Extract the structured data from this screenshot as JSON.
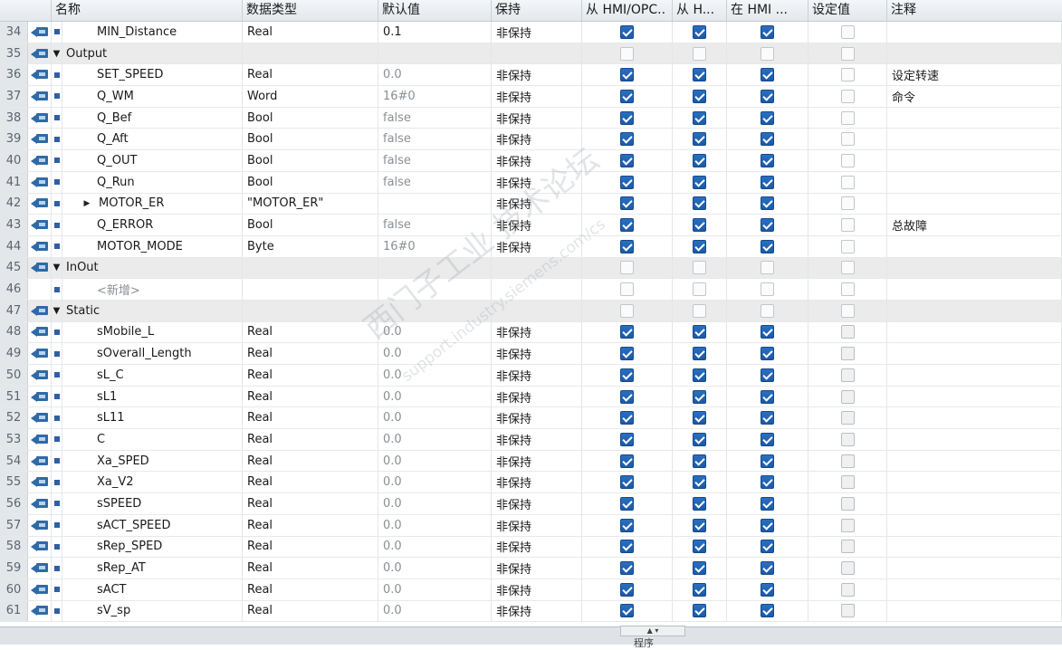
{
  "headers": {
    "name": "名称",
    "type": "数据类型",
    "default": "默认值",
    "retain": "保持",
    "col_hmi_opc": "从 HMI/OPC..",
    "col_h": "从 H...",
    "col_in_hmi": "在 HMI ...",
    "col_setpoint": "设定值",
    "comment": "注释"
  },
  "rows": [
    {
      "n": "34",
      "kind": "var",
      "name": "MIN_Distance",
      "type": "Real",
      "dflt": "0.1",
      "dflt_style": "bright",
      "keep": "非保持",
      "c1": "on",
      "c2": "on",
      "c3": "on",
      "c4": "off",
      "cmt": ""
    },
    {
      "n": "35",
      "kind": "section",
      "name": "Output"
    },
    {
      "n": "36",
      "kind": "var",
      "name": "SET_SPEED",
      "type": "Real",
      "dflt": "0.0",
      "keep": "非保持",
      "c1": "on",
      "c2": "on",
      "c3": "on",
      "c4": "off",
      "cmt": "设定转速"
    },
    {
      "n": "37",
      "kind": "var",
      "name": "Q_WM",
      "type": "Word",
      "dflt": "16#0",
      "keep": "非保持",
      "c1": "on",
      "c2": "on",
      "c3": "on",
      "c4": "off",
      "cmt": "命令"
    },
    {
      "n": "38",
      "kind": "var",
      "name": "Q_Bef",
      "type": "Bool",
      "dflt": "false",
      "keep": "非保持",
      "c1": "on",
      "c2": "on",
      "c3": "on",
      "c4": "off",
      "cmt": ""
    },
    {
      "n": "39",
      "kind": "var",
      "name": "Q_Aft",
      "type": "Bool",
      "dflt": "false",
      "keep": "非保持",
      "c1": "on",
      "c2": "on",
      "c3": "on",
      "c4": "off",
      "cmt": ""
    },
    {
      "n": "40",
      "kind": "var",
      "name": "Q_OUT",
      "type": "Bool",
      "dflt": "false",
      "keep": "非保持",
      "c1": "on",
      "c2": "on",
      "c3": "on",
      "c4": "off",
      "cmt": ""
    },
    {
      "n": "41",
      "kind": "var",
      "name": "Q_Run",
      "type": "Bool",
      "dflt": "false",
      "keep": "非保持",
      "c1": "on",
      "c2": "on",
      "c3": "on",
      "c4": "off",
      "cmt": ""
    },
    {
      "n": "42",
      "kind": "struct",
      "name": "MOTOR_ER",
      "type": "\"MOTOR_ER\"",
      "dflt": "",
      "keep": "非保持",
      "c1": "on",
      "c2": "on",
      "c3": "on",
      "c4": "off",
      "cmt": ""
    },
    {
      "n": "43",
      "kind": "var",
      "name": "Q_ERROR",
      "type": "Bool",
      "dflt": "false",
      "keep": "非保持",
      "c1": "on",
      "c2": "on",
      "c3": "on",
      "c4": "off",
      "cmt": "总故障"
    },
    {
      "n": "44",
      "kind": "var",
      "name": "MOTOR_MODE",
      "type": "Byte",
      "dflt": "16#0",
      "keep": "非保持",
      "c1": "on",
      "c2": "on",
      "c3": "on",
      "c4": "off",
      "cmt": ""
    },
    {
      "n": "45",
      "kind": "section",
      "name": "InOut"
    },
    {
      "n": "46",
      "kind": "placeholder",
      "name": "<新增>"
    },
    {
      "n": "47",
      "kind": "section",
      "name": "Static"
    },
    {
      "n": "48",
      "kind": "var",
      "name": "sMobile_L",
      "type": "Real",
      "dflt": "0.0",
      "keep": "非保持",
      "c1": "on",
      "c2": "on",
      "c3": "on",
      "c4": "offd",
      "cmt": ""
    },
    {
      "n": "49",
      "kind": "var",
      "name": "sOverall_Length",
      "type": "Real",
      "dflt": "0.0",
      "keep": "非保持",
      "c1": "on",
      "c2": "on",
      "c3": "on",
      "c4": "offd",
      "cmt": ""
    },
    {
      "n": "50",
      "kind": "var",
      "name": "sL_C",
      "type": "Real",
      "dflt": "0.0",
      "keep": "非保持",
      "c1": "on",
      "c2": "on",
      "c3": "on",
      "c4": "offd",
      "cmt": ""
    },
    {
      "n": "51",
      "kind": "var",
      "name": "sL1",
      "type": "Real",
      "dflt": "0.0",
      "keep": "非保持",
      "c1": "on",
      "c2": "on",
      "c3": "on",
      "c4": "offd",
      "cmt": ""
    },
    {
      "n": "52",
      "kind": "var",
      "name": "sL11",
      "type": "Real",
      "dflt": "0.0",
      "keep": "非保持",
      "c1": "on",
      "c2": "on",
      "c3": "on",
      "c4": "offd",
      "cmt": ""
    },
    {
      "n": "53",
      "kind": "var",
      "name": "C",
      "type": "Real",
      "dflt": "0.0",
      "keep": "非保持",
      "c1": "on",
      "c2": "on",
      "c3": "on",
      "c4": "offd",
      "cmt": ""
    },
    {
      "n": "54",
      "kind": "var",
      "name": "Xa_SPED",
      "type": "Real",
      "dflt": "0.0",
      "keep": "非保持",
      "c1": "on",
      "c2": "on",
      "c3": "on",
      "c4": "offd",
      "cmt": ""
    },
    {
      "n": "55",
      "kind": "var",
      "name": "Xa_V2",
      "type": "Real",
      "dflt": "0.0",
      "keep": "非保持",
      "c1": "on",
      "c2": "on",
      "c3": "on",
      "c4": "offd",
      "cmt": ""
    },
    {
      "n": "56",
      "kind": "var",
      "name": "sSPEED",
      "type": "Real",
      "dflt": "0.0",
      "keep": "非保持",
      "c1": "on",
      "c2": "on",
      "c3": "on",
      "c4": "offd",
      "cmt": ""
    },
    {
      "n": "57",
      "kind": "var",
      "name": "sACT_SPEED",
      "type": "Real",
      "dflt": "0.0",
      "keep": "非保持",
      "c1": "on",
      "c2": "on",
      "c3": "on",
      "c4": "offd",
      "cmt": ""
    },
    {
      "n": "58",
      "kind": "var",
      "name": "sRep_SPED",
      "type": "Real",
      "dflt": "0.0",
      "keep": "非保持",
      "c1": "on",
      "c2": "on",
      "c3": "on",
      "c4": "offd",
      "cmt": ""
    },
    {
      "n": "59",
      "kind": "var",
      "name": "sRep_AT",
      "type": "Real",
      "dflt": "0.0",
      "keep": "非保持",
      "c1": "on",
      "c2": "on",
      "c3": "on",
      "c4": "offd",
      "cmt": ""
    },
    {
      "n": "60",
      "kind": "var",
      "name": "sACT",
      "type": "Real",
      "dflt": "0.0",
      "keep": "非保持",
      "c1": "on",
      "c2": "on",
      "c3": "on",
      "c4": "offd",
      "cmt": ""
    },
    {
      "n": "61",
      "kind": "var",
      "name": "sV_sp",
      "type": "Real",
      "dflt": "0.0",
      "keep": "非保持",
      "c1": "on",
      "c2": "on",
      "c3": "on",
      "c4": "offd",
      "cmt": ""
    }
  ],
  "bottom_label": "程序",
  "watermark": "西门子工业 技术论坛",
  "watermark_url": "support.industry.siemens.com/cs",
  "colors": {
    "accent": "#2a6fc0",
    "section_bg": "#ebebeb",
    "header_bg": "#e3e8ec"
  }
}
